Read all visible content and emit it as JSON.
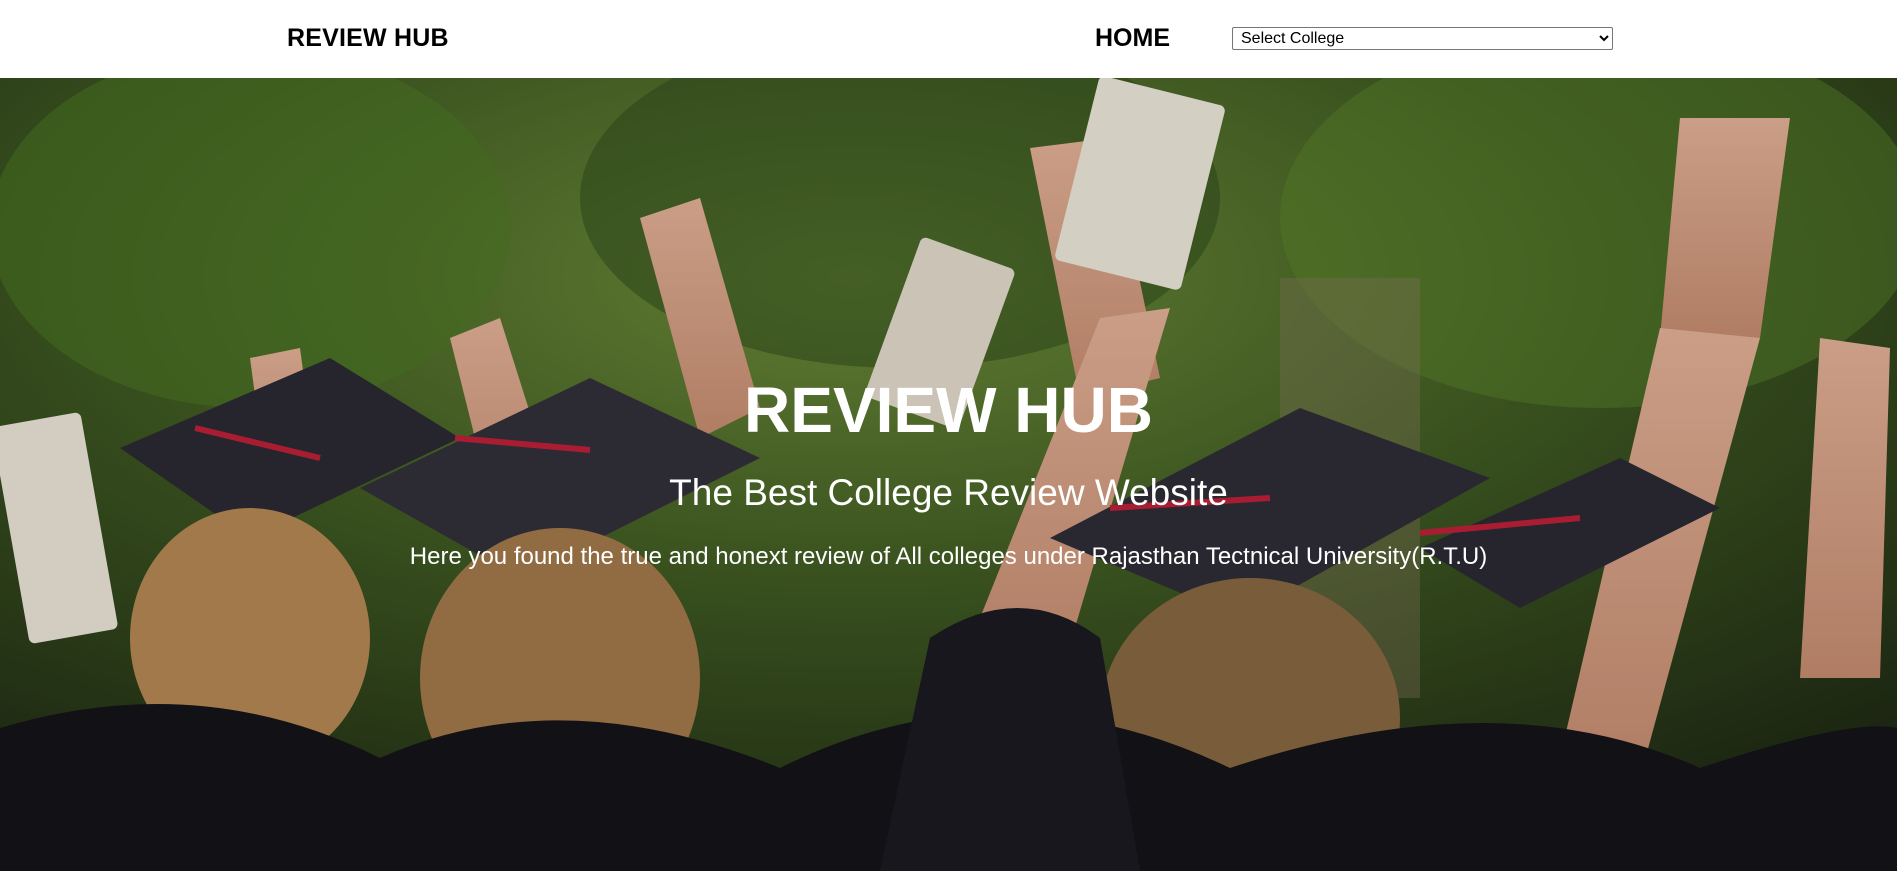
{
  "navbar": {
    "brand": "REVIEW HUB",
    "home_label": "HOME",
    "college_select": {
      "selected": "Select College",
      "options": [
        "Select College"
      ]
    }
  },
  "hero": {
    "title": "REVIEW HUB",
    "subtitle": "The Best College Review Website",
    "description": "Here you found the true and honext review of All colleges under Rajasthan Tectnical University(R.T.U)"
  }
}
